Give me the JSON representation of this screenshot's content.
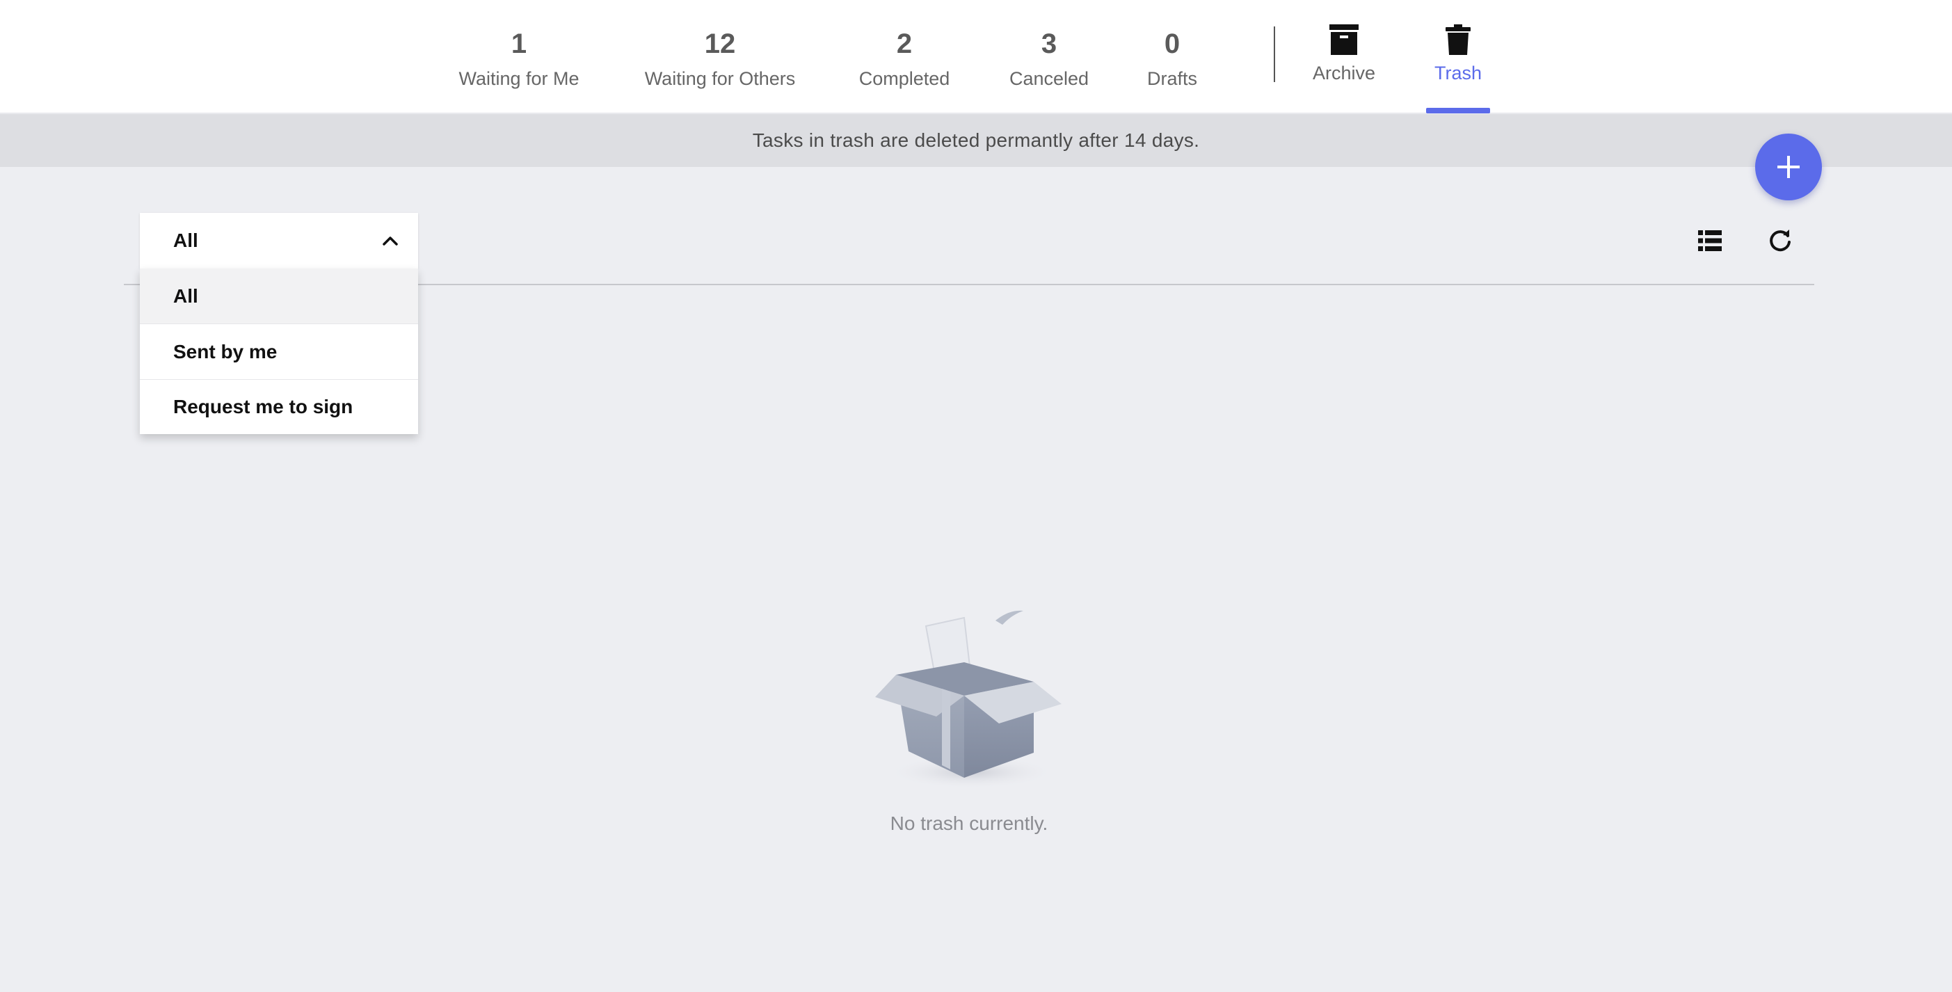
{
  "tabs": [
    {
      "count": "1",
      "label": "Waiting for Me"
    },
    {
      "count": "12",
      "label": "Waiting for Others"
    },
    {
      "count": "2",
      "label": "Completed"
    },
    {
      "count": "3",
      "label": "Canceled"
    },
    {
      "count": "0",
      "label": "Drafts"
    }
  ],
  "icon_tabs": [
    {
      "label": "Archive",
      "icon": "archive-box-icon"
    },
    {
      "label": "Trash",
      "icon": "trash-can-icon",
      "active": true
    }
  ],
  "notice": "Tasks in trash are deleted permantly after 14 days.",
  "filter": {
    "selected": "All",
    "options": [
      "All",
      "Sent by me",
      "Request me to sign"
    ]
  },
  "toolbar": {
    "icons": [
      "list-view-icon",
      "refresh-icon"
    ]
  },
  "fab": {
    "icon": "plus-icon"
  },
  "empty_state": {
    "illustration": "open-box-illustration",
    "text": "No trash currently."
  },
  "colors": {
    "accent": "#5b6bea",
    "background": "#edeef2",
    "banner": "#dddee2"
  }
}
